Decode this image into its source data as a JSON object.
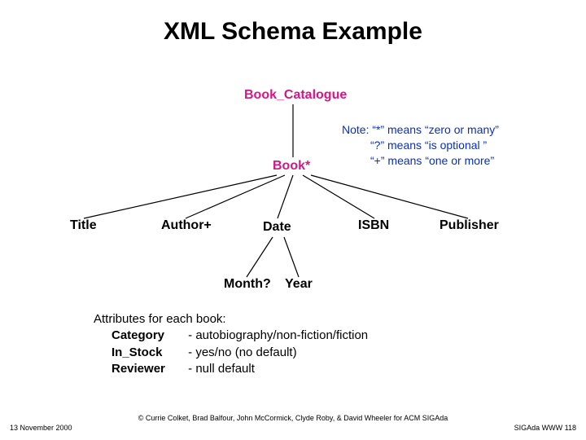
{
  "title": "XML Schema Example",
  "tree": {
    "root": "Book_Catalogue",
    "book": "Book*",
    "children": [
      "Title",
      "Author+",
      "Date",
      "ISBN",
      "Publisher"
    ],
    "date_children": [
      "Month?",
      "Year"
    ]
  },
  "note": {
    "line1": "Note: “*” means “zero or many”",
    "line2": "“?” means “is optional ”",
    "line3": "“+” means “one or more”"
  },
  "attrs": {
    "header": "Attributes for each book:",
    "items": [
      {
        "name": "Category",
        "desc": "- autobiography/non-fiction/fiction"
      },
      {
        "name": "In_Stock",
        "desc": "- yes/no (no default)"
      },
      {
        "name": "Reviewer",
        "desc": "- null default"
      }
    ]
  },
  "footer": {
    "left": "13 November 2000",
    "right": "SIGAda WWW 118",
    "center": "© Currie Colket, Brad Balfour, John McCormick, Clyde Roby, & David Wheeler for ACM SIGAda"
  }
}
